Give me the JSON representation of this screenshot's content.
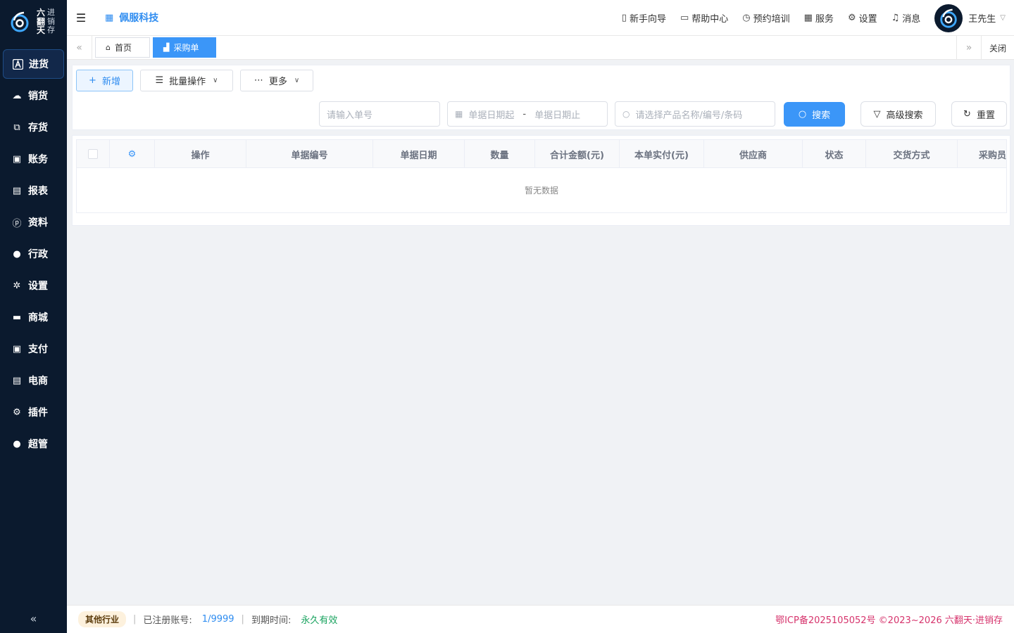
{
  "brand": {
    "name_col1": [
      "六",
      "翻",
      "天"
    ],
    "name_col2": [
      "进",
      "销",
      "存"
    ]
  },
  "sidebar": {
    "items": [
      {
        "label": "进货",
        "icon": "purchase-icon",
        "active": true
      },
      {
        "label": "销货",
        "icon": "sales-icon"
      },
      {
        "label": "存货",
        "icon": "inventory-icon"
      },
      {
        "label": "账务",
        "icon": "accounts-icon"
      },
      {
        "label": "报表",
        "icon": "report-icon"
      },
      {
        "label": "资料",
        "icon": "data-icon"
      },
      {
        "label": "行政",
        "icon": "admin-icon"
      },
      {
        "label": "设置",
        "icon": "settings-icon"
      },
      {
        "label": "商城",
        "icon": "mall-icon"
      },
      {
        "label": "支付",
        "icon": "payment-icon"
      },
      {
        "label": "电商",
        "icon": "ecommerce-icon"
      },
      {
        "label": "插件",
        "icon": "plugin-icon"
      },
      {
        "label": "超管",
        "icon": "superadmin-icon"
      }
    ]
  },
  "header": {
    "company": "佩服科技",
    "links": [
      "新手向导",
      "帮助中心",
      "预约培训",
      "服务",
      "设置",
      "消息"
    ],
    "user": "王先生"
  },
  "tabs": {
    "home": "首页",
    "active": "采购单",
    "close": "关闭"
  },
  "toolbar": {
    "new": "新增",
    "batch": "批量操作",
    "more": "更多"
  },
  "search": {
    "order_placeholder": "请输入单号",
    "date_start": "单据日期起",
    "date_sep": "-",
    "date_end": "单据日期止",
    "product_placeholder": "请选择产品名称/编号/条码",
    "search_btn": "搜索",
    "advanced_btn": "高级搜索",
    "reset_btn": "重置"
  },
  "table": {
    "columns": [
      "操作",
      "单据编号",
      "单据日期",
      "数量",
      "合计金额(元)",
      "本单实付(元)",
      "供应商",
      "状态",
      "交货方式",
      "采购员"
    ],
    "empty": "暂无数据"
  },
  "footer": {
    "industry": "其他行业",
    "registered_label": "已注册账号:",
    "registered_value": "1/9999",
    "expire_label": "到期时间:",
    "expire_value": "永久有效",
    "copyright": "鄂ICP备2025105052号 ©2023~2026 六翻天·进销存"
  },
  "colors": {
    "accent": "#3b96f8",
    "sidebar_bg": "#0b1a2e",
    "copyright": "#d6336c",
    "success": "#19a35f"
  }
}
